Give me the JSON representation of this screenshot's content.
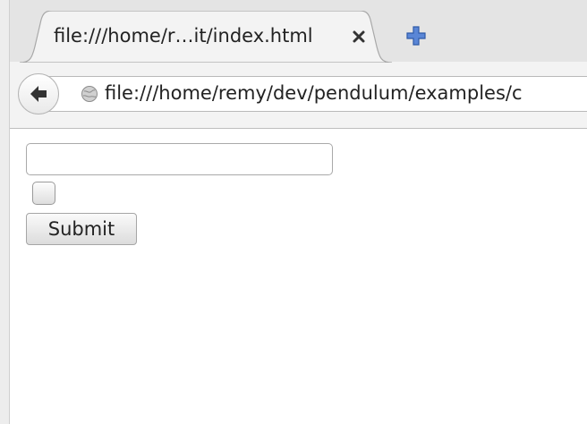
{
  "tab": {
    "title": "file:///home/r…it/index.html",
    "close_icon": "close-icon",
    "new_tab_icon": "new-tab-icon"
  },
  "toolbar": {
    "back_icon": "back-arrow-icon",
    "page_icon": "globe-icon",
    "url": "file:///home/remy/dev/pendulum/examples/c"
  },
  "form": {
    "text_value": "",
    "checkbox_checked": false,
    "submit_label": "Submit"
  },
  "colors": {
    "new_tab_blue": "#4a78c8",
    "tab_strip": "#e4e4e4",
    "toolbar": "#f3f3f3"
  }
}
